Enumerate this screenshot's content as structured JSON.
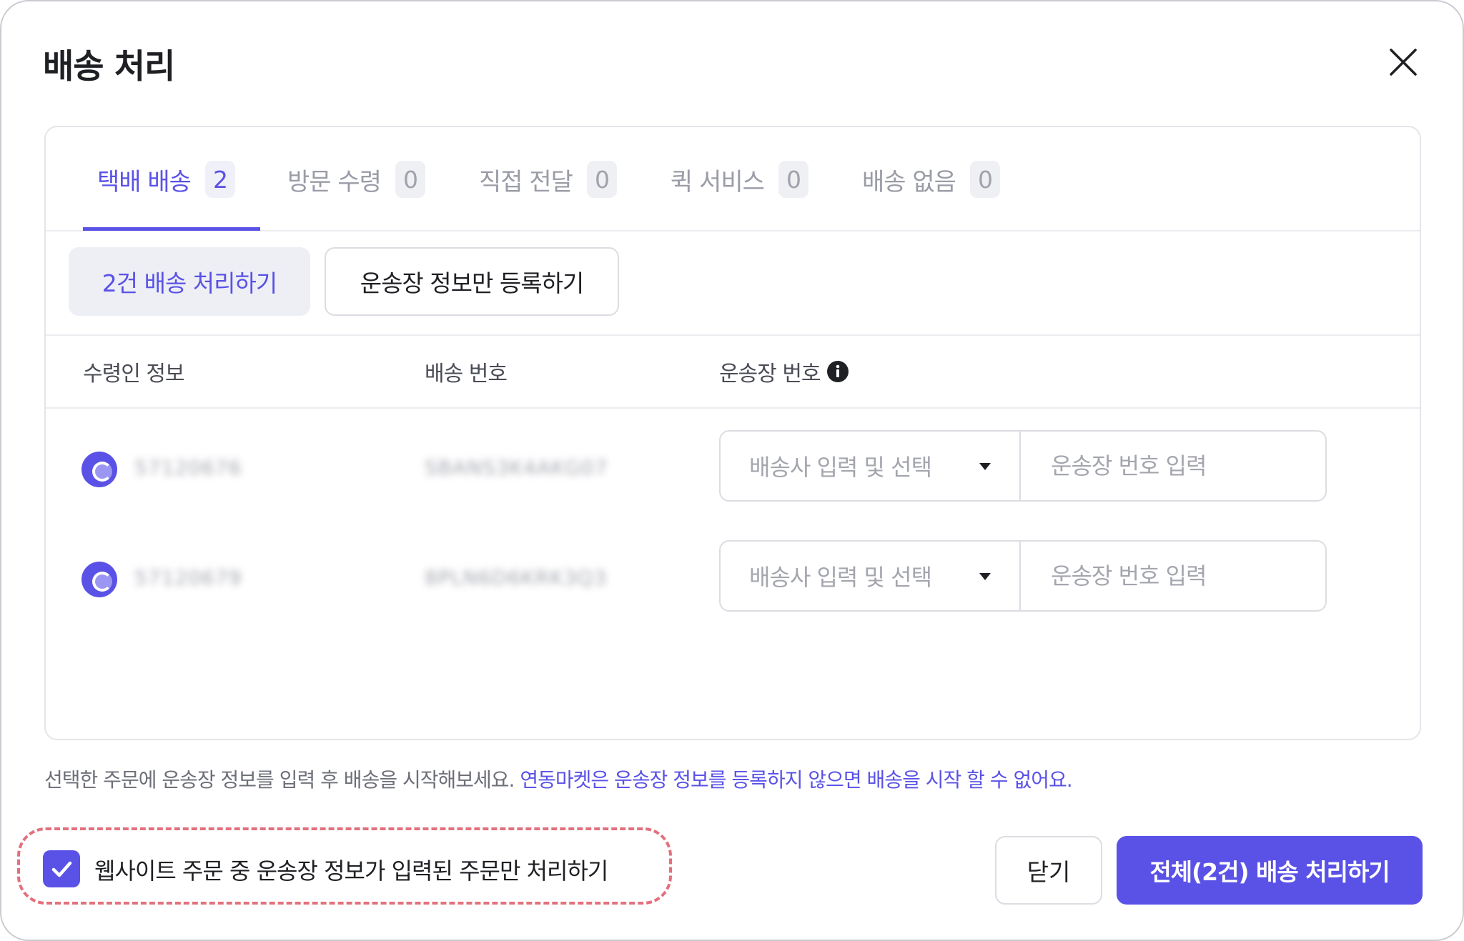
{
  "dialog": {
    "title": "배송 처리"
  },
  "tabs": [
    {
      "label": "택배 배송",
      "count": "2"
    },
    {
      "label": "방문 수령",
      "count": "0"
    },
    {
      "label": "직접 전달",
      "count": "0"
    },
    {
      "label": "퀵 서비스",
      "count": "0"
    },
    {
      "label": "배송 없음",
      "count": "0"
    }
  ],
  "actions": {
    "process_selected": "2건 배송 처리하기",
    "register_tracking_only": "운송장 정보만 등록하기"
  },
  "table": {
    "headers": {
      "recipient": "수령인 정보",
      "shipping_no": "배송 번호",
      "tracking_no": "운송장 번호"
    },
    "rows": [
      {
        "recipient": "5712067​6",
        "shipping_no": "SBANS3K4AKG07",
        "carrier_placeholder": "배송사 입력 및 선택",
        "tracking_placeholder": "운송장 번호 입력"
      },
      {
        "recipient": "57120679",
        "shipping_no": "8PLN6D6KRK3Q3",
        "carrier_placeholder": "배송사 입력 및 선택",
        "tracking_placeholder": "운송장 번호 입력"
      }
    ]
  },
  "notice": {
    "text": "선택한 주문에 운송장 정보를 입력 후 배송을 시작해보세요. ",
    "highlight": "연동마켓은 운송장 정보를 등록하지 않으면 배송을 시작 할 수 없어요."
  },
  "option": {
    "checked": true,
    "label": "웹사이트 주문 중 운송장 정보가 입력된 주문만 처리하기"
  },
  "footer": {
    "close_label": "닫기",
    "submit_label": "전체(2건) 배송 처리하기"
  },
  "colors": {
    "accent": "#5a52e6",
    "highlight_border": "#e2707d"
  }
}
